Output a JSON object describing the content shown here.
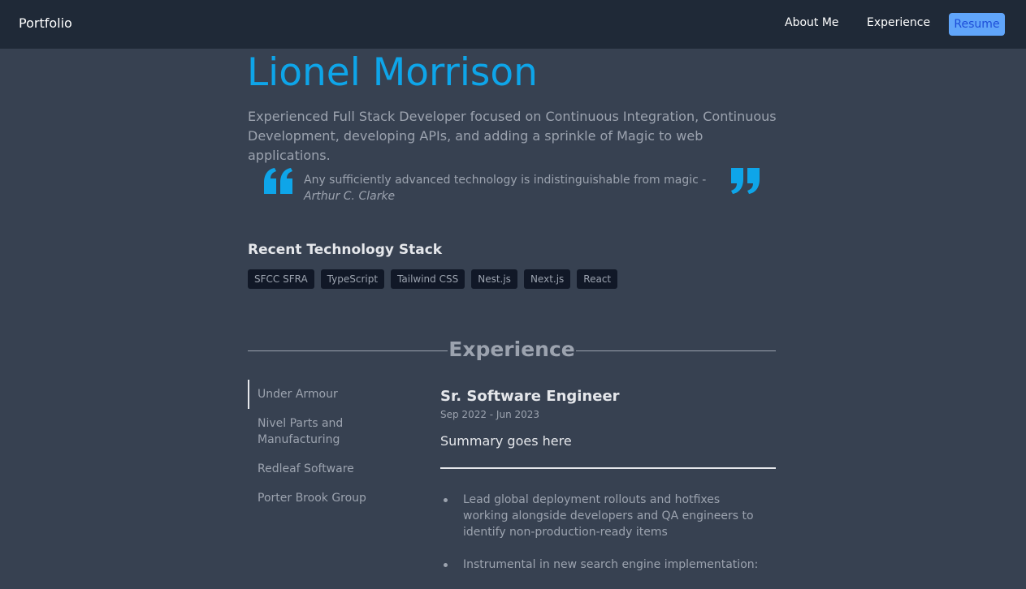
{
  "nav": {
    "brand": "Portfolio",
    "links": [
      "About Me",
      "Experience"
    ],
    "resume_label": "Resume"
  },
  "hero": {
    "name": "Lionel Morrison",
    "intro": "Experienced Full Stack Developer focused on Continuous Integration, Continuous Development, developing APIs, and adding a sprinkle of Magic to web applications.",
    "quote": "Any sufficiently advanced technology is indistinguishable from magic -",
    "quote_author": "Arthur C. Clarke"
  },
  "stack": {
    "heading": "Recent Technology Stack",
    "tags": [
      "SFCC SFRA",
      "TypeScript",
      "Tailwind CSS",
      "Nest.js",
      "Next.js",
      "React"
    ]
  },
  "experience": {
    "heading": "Experience",
    "companies": [
      "Under Armour",
      "Nivel Parts and Manufacturing",
      "Redleaf Software",
      "Porter Brook Group"
    ],
    "active_index": 0,
    "job": {
      "title": "Sr. Software Engineer",
      "dates": "Sep 2022 - Jun 2023",
      "summary": "Summary goes here",
      "bullets": [
        "Lead global deployment rollouts and hotfixes working alongside developers and QA engineers to identify non-production-ready items",
        "Instrumental in new search engine implementation:"
      ]
    }
  },
  "colors": {
    "accent": "#0ea5e9",
    "background": "#374151",
    "navbar": "#1f2937",
    "resume_button": "#60a5fa"
  }
}
